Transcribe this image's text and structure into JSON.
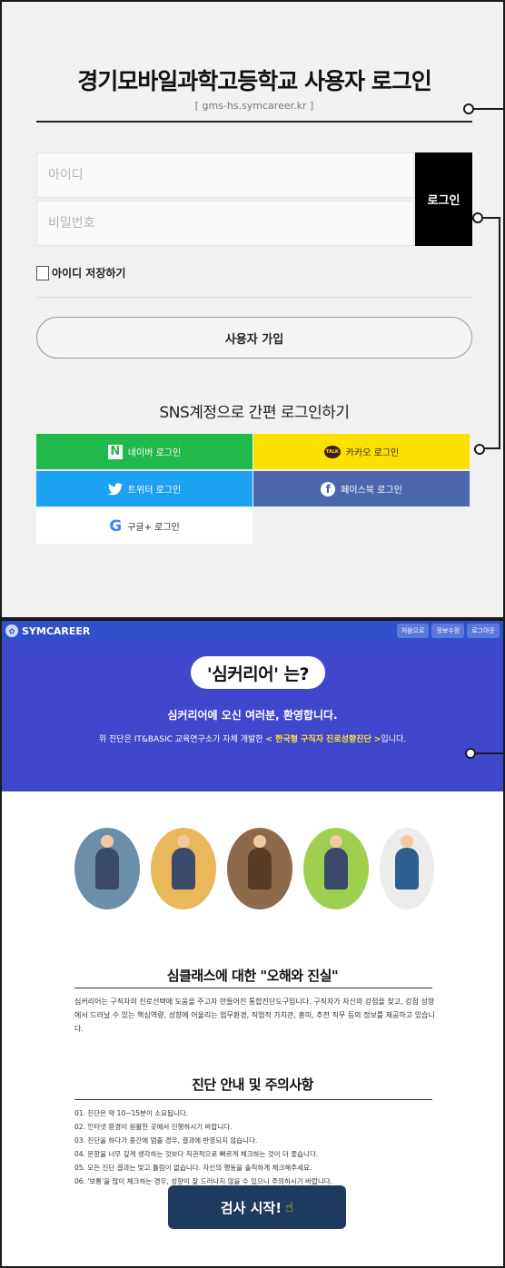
{
  "login": {
    "title": "경기모바일과학고등학교 사용자 로그인",
    "subtitle": "[ gms-hs.symcareer.kr ]",
    "id_placeholder": "아이디",
    "pw_placeholder": "비밀번호",
    "login_label": "로그인",
    "remember_label": "아이디 저장하기",
    "signup_label": "사용자 가입",
    "sns_title": "SNS계정으로 간편 로그인하기",
    "sns": {
      "naver": {
        "label": "네이버 로그인",
        "icon": "naver-icon",
        "color": "#21b94b",
        "glyph": "N"
      },
      "kakao": {
        "label": "카카오 로그인",
        "icon": "kakao-talk-icon",
        "color": "#fae100",
        "glyph": "TALK"
      },
      "twitter": {
        "label": "트위터 로그인",
        "icon": "twitter-bird-icon",
        "color": "#1da1f2"
      },
      "facebook": {
        "label": "페이스북 로그인",
        "icon": "facebook-icon",
        "color": "#4a68ab",
        "glyph": "f"
      },
      "google": {
        "label": "구글+ 로그인",
        "icon": "google-icon",
        "color": "#ffffff",
        "glyph": "G"
      }
    }
  },
  "symcareer": {
    "logo_text": "SYMCAREER",
    "nav": [
      "처음으로",
      "정보수정",
      "로그아웃"
    ],
    "hero_pill": "'심커리어' 는?",
    "welcome": "심커리어에 오신 여러분, 환영합니다.",
    "intro_prefix": "위 진단은 IT&BASIC 교육연구소가 자체 개발한 ",
    "intro_highlight": "< 한국형 구직자 진로성향진단 >",
    "intro_suffix": "입니다.",
    "accent_color": "#3f48cc",
    "myth_title": "심클래스에 대한 \"오해와 진실\"",
    "myth_text": "심커리어는 구직자의 진로선택에 도움을 주고자 만들어진 통합진단도구입니다. 구직자가 자신의 강점을 찾고, 강점 성향에서 드러날 수 있는 핵심역량, 성향에 어울리는 업무환경, 직업적 가치관, 흥미, 추천 직무 등의 정보를 제공하고 있습니다.",
    "guide_title": "진단 안내 및 주의사항",
    "guide_items": [
      "01. 진단은 약 10~15분이 소요됩니다.",
      "02. 인터넷 환경이 원활한 곳에서 진행하시기 바랍니다.",
      "03. 진단을 하다가 중간에 멈출 경우, 결과에 반영되지 않습니다.",
      "04. 문항을 너무 깊게 생각하는 것보다 직관적으로 빠르게 체크하는 것이 더 좋습니다.",
      "05. 모든 진단 결과는 맞고 틀림이 없습니다. 자신의 행동을 솔직하게 체크해주세요.",
      "06. '보통'을 많이 체크하는 경우, 성향이 잘 드러나지 않을 수 있으니 주의하시기 바랍니다."
    ],
    "start_label": "검사 시작!",
    "start_icon": "pointing-hand-icon"
  }
}
